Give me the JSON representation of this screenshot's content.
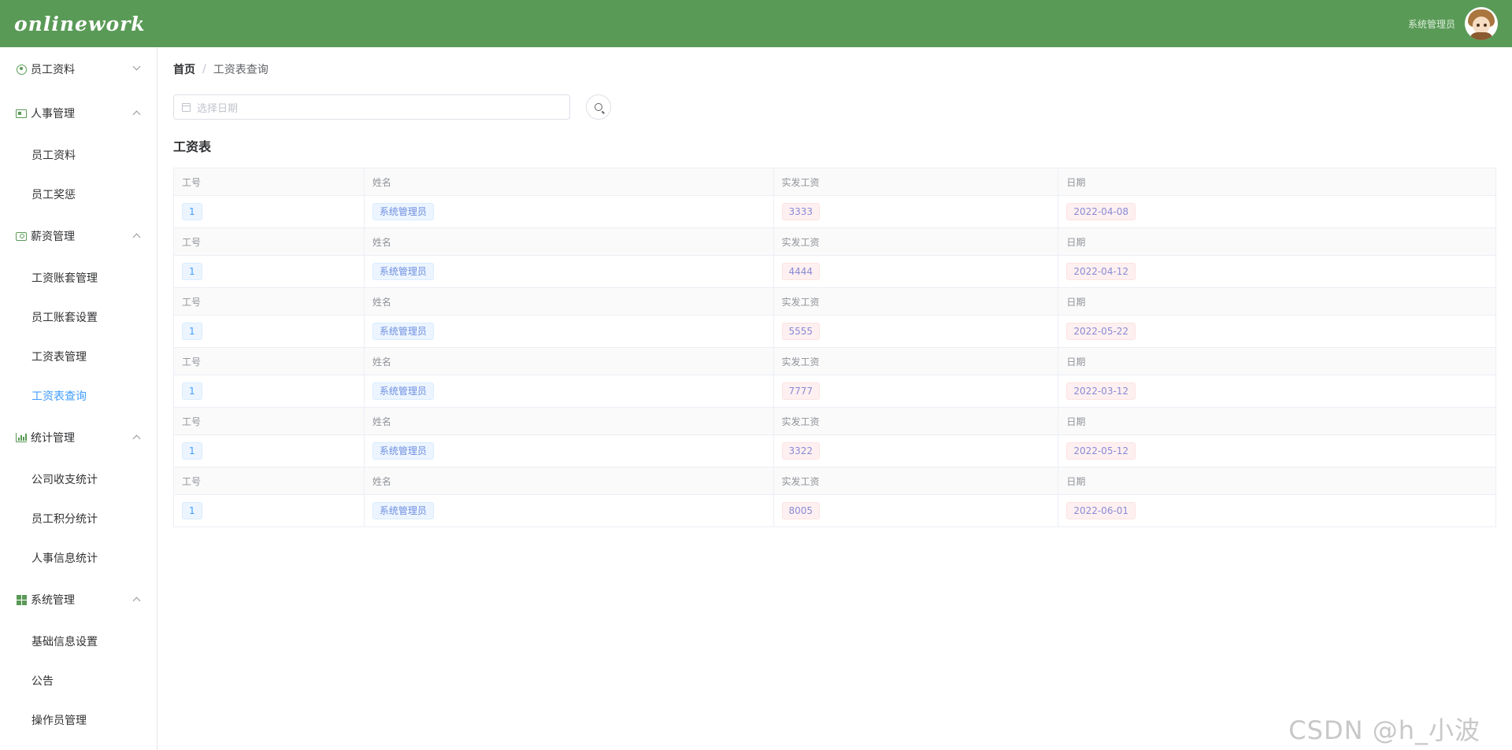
{
  "header": {
    "logo": "onlinework",
    "user_name": "系统管理员",
    "brand_color": "#5a9a57"
  },
  "sidebar": {
    "groups": [
      {
        "title": "员工资料",
        "icon": "user-circle-icon",
        "expanded": false,
        "items": []
      },
      {
        "title": "人事管理",
        "icon": "id-card-icon",
        "expanded": true,
        "items": [
          "员工资料",
          "员工奖惩"
        ]
      },
      {
        "title": "薪资管理",
        "icon": "money-icon",
        "expanded": true,
        "items": [
          "工资账套管理",
          "员工账套设置",
          "工资表管理",
          "工资表查询"
        ]
      },
      {
        "title": "统计管理",
        "icon": "bar-chart-icon",
        "expanded": true,
        "items": [
          "公司收支统计",
          "员工积分统计",
          "人事信息统计"
        ]
      },
      {
        "title": "系统管理",
        "icon": "windows-icon",
        "expanded": true,
        "items": [
          "基础信息设置",
          "公告",
          "操作员管理"
        ]
      }
    ],
    "active_item": "工资表查询"
  },
  "breadcrumb": {
    "home": "首页",
    "separator": "/",
    "current": "工资表查询"
  },
  "filter": {
    "date_placeholder": "选择日期"
  },
  "table": {
    "title": "工资表",
    "headers": [
      "工号",
      "姓名",
      "实发工资",
      "日期"
    ],
    "rows": [
      {
        "id": "1",
        "name": "系统管理员",
        "salary": "3333",
        "date": "2022-04-08"
      },
      {
        "id": "1",
        "name": "系统管理员",
        "salary": "4444",
        "date": "2022-04-12"
      },
      {
        "id": "1",
        "name": "系统管理员",
        "salary": "5555",
        "date": "2022-05-22"
      },
      {
        "id": "1",
        "name": "系统管理员",
        "salary": "7777",
        "date": "2022-03-12"
      },
      {
        "id": "1",
        "name": "系统管理员",
        "salary": "3322",
        "date": "2022-05-12"
      },
      {
        "id": "1",
        "name": "系统管理员",
        "salary": "8005",
        "date": "2022-06-01"
      }
    ]
  },
  "watermark": "CSDN @h_小波"
}
